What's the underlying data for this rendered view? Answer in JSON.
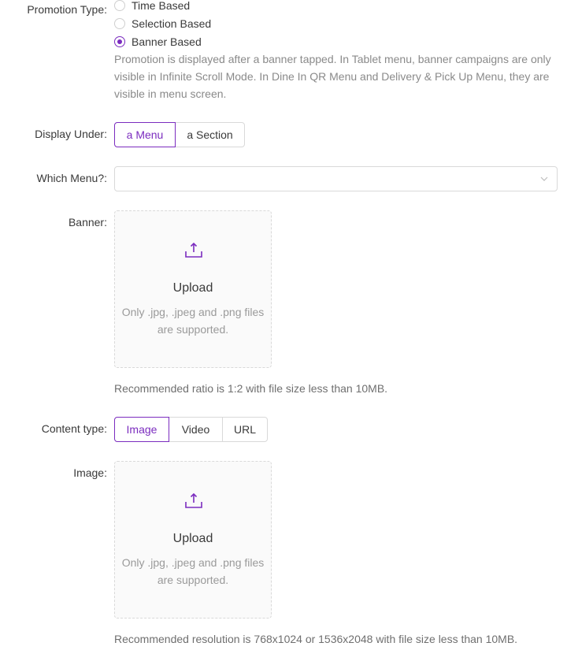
{
  "promotion_type": {
    "label": "Promotion Type:",
    "options": [
      {
        "label": "Time Based",
        "checked": false
      },
      {
        "label": "Selection Based",
        "checked": false
      },
      {
        "label": "Banner Based",
        "checked": true
      }
    ],
    "description": "Promotion is displayed after a banner tapped. In Tablet menu, banner campaigns are only visible in Infinite Scroll Mode. In Dine In QR Menu and Delivery & Pick Up Menu, they are visible in menu screen."
  },
  "display_under": {
    "label": "Display Under:",
    "options": [
      "a Menu",
      "a Section"
    ],
    "selected": "a Menu"
  },
  "which_menu": {
    "label": "Which Menu?:",
    "value": ""
  },
  "banner": {
    "label": "Banner:",
    "upload_title": "Upload",
    "upload_hint": "Only .jpg, .jpeg and .png files are supported.",
    "note": "Recommended ratio is 1:2 with file size less than 10MB."
  },
  "content_type": {
    "label": "Content type:",
    "options": [
      "Image",
      "Video",
      "URL"
    ],
    "selected": "Image"
  },
  "image": {
    "label": "Image:",
    "upload_title": "Upload",
    "upload_hint": "Only .jpg, .jpeg and .png files are supported.",
    "note": "Recommended resolution is 768x1024 or 1536x2048 with file size less than 10MB."
  },
  "colors": {
    "accent": "#7b2cbf",
    "border": "#d9d9d9",
    "muted_text": "#8a8a8a"
  },
  "icons": {
    "upload": "upload-icon",
    "select_arrow": "chevron-down-icon"
  }
}
